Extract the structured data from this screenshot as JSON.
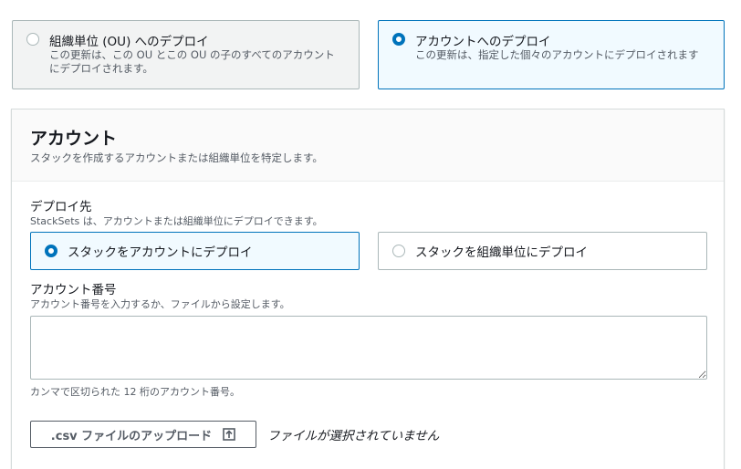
{
  "deploy_target_tiles": [
    {
      "title": "組織単位 (OU) へのデプロイ",
      "description_line1": "この更新は、この OU とこの OU の子のすべてのアカウント",
      "description_line2": "にデプロイされます。",
      "selected": false
    },
    {
      "title": "アカウントへのデプロイ",
      "description_line1": "この更新は、指定した個々のアカウントにデプロイされます",
      "selected": true
    }
  ],
  "accounts_panel": {
    "title": "アカウント",
    "description": "スタックを作成するアカウントまたは組織単位を特定します。",
    "deploy_location": {
      "label": "デプロイ先",
      "hint": "StackSets は、アカウントまたは組織単位にデプロイできます。",
      "options": [
        {
          "label": "スタックをアカウントにデプロイ",
          "selected": true
        },
        {
          "label": "スタックを組織単位にデプロイ",
          "selected": false
        }
      ]
    },
    "account_numbers": {
      "label": "アカウント番号",
      "hint": "アカウント番号を入力するか、ファイルから設定します。",
      "value": "",
      "constraint": "カンマで区切られた 12 桁のアカウント番号。"
    },
    "upload": {
      "button_label": ".csv ファイルのアップロード",
      "status": "ファイルが選択されていません"
    }
  },
  "colors": {
    "accent": "#0073bb",
    "selected_bg": "#f1faff",
    "border": "#aab7b8",
    "secondary_text": "#545b64"
  }
}
